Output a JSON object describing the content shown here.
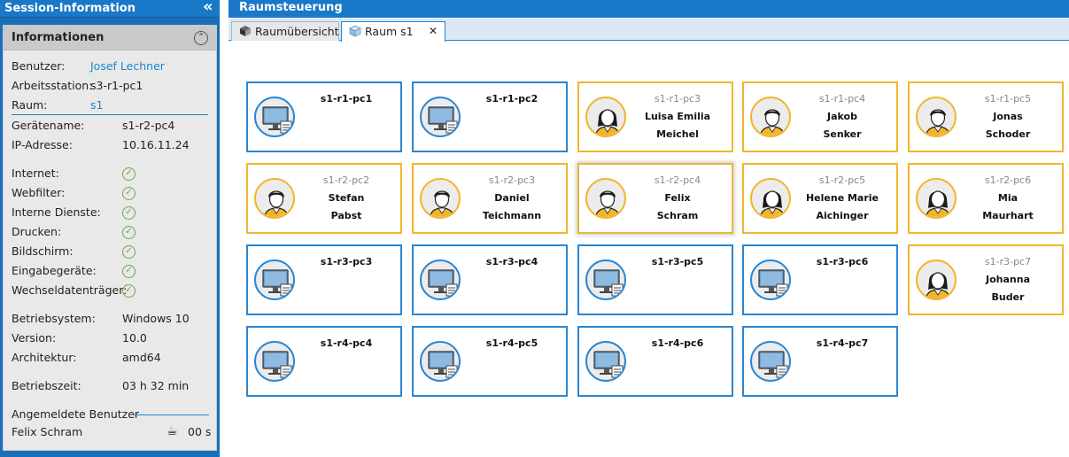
{
  "left": {
    "title": "Session-Information",
    "panel_title": "Informationen",
    "fields": {
      "benutzer_label": "Benutzer:",
      "benutzer_value": "Josef Lechner",
      "arbeitsstation_label": "Arbeitsstation:",
      "arbeitsstation_value": "s3-r1-pc1",
      "raum_label": "Raum:",
      "raum_value": "s1",
      "geraetename_label": "Gerätename:",
      "geraetename_value": "s1-r2-pc4",
      "ip_label": "IP-Adresse:",
      "ip_value": "10.16.11.24",
      "internet_label": "Internet:",
      "webfilter_label": "Webfilter:",
      "interne_label": "Interne Dienste:",
      "drucken_label": "Drucken:",
      "bildschirm_label": "Bildschirm:",
      "eingabe_label": "Eingabegeräte:",
      "wechsel_label": "Wechseldatenträger:",
      "bs_label": "Betriebsystem:",
      "bs_value": "Windows 10",
      "version_label": "Version:",
      "version_value": "10.0",
      "arch_label": "Architektur:",
      "arch_value": "amd64",
      "uptime_label": "Betriebszeit:",
      "uptime_value": "03 h 32 min",
      "logged_label": "Angemeldete Benutzer",
      "logged_user": "Felix Schram",
      "logged_time": "00 s"
    }
  },
  "right": {
    "title": "Raumsteuerung",
    "tabs": [
      {
        "label": "Raumübersicht"
      },
      {
        "label": "Raum s1",
        "close": "✕"
      }
    ],
    "cards": [
      {
        "pc": "s1-r1-pc1"
      },
      {
        "pc": "s1-r1-pc2"
      },
      {
        "pc": "s1-r1-pc3",
        "first": "Luisa Emilia",
        "last": "Meichel"
      },
      {
        "pc": "s1-r1-pc4",
        "first": "Jakob",
        "last": "Senker"
      },
      {
        "pc": "s1-r1-pc5",
        "first": "Jonas",
        "last": "Schoder"
      },
      {
        "pc": "s1-r2-pc2",
        "first": "Stefan",
        "last": "Pabst"
      },
      {
        "pc": "s1-r2-pc3",
        "first": "Daniel",
        "last": "Teichmann"
      },
      {
        "pc": "s1-r2-pc4",
        "first": "Felix",
        "last": "Schram"
      },
      {
        "pc": "s1-r2-pc5",
        "first": "Helene Marie",
        "last": "Aichinger"
      },
      {
        "pc": "s1-r2-pc6",
        "first": "Mia",
        "last": "Maurhart"
      },
      {
        "pc": "s1-r3-pc3"
      },
      {
        "pc": "s1-r3-pc4"
      },
      {
        "pc": "s1-r3-pc5"
      },
      {
        "pc": "s1-r3-pc6"
      },
      {
        "pc": "s1-r3-pc7",
        "first": "Johanna",
        "last": "Buder"
      },
      {
        "pc": "s1-r4-pc4"
      },
      {
        "pc": "s1-r4-pc5"
      },
      {
        "pc": "s1-r4-pc6"
      },
      {
        "pc": "s1-r4-pc7"
      }
    ]
  }
}
